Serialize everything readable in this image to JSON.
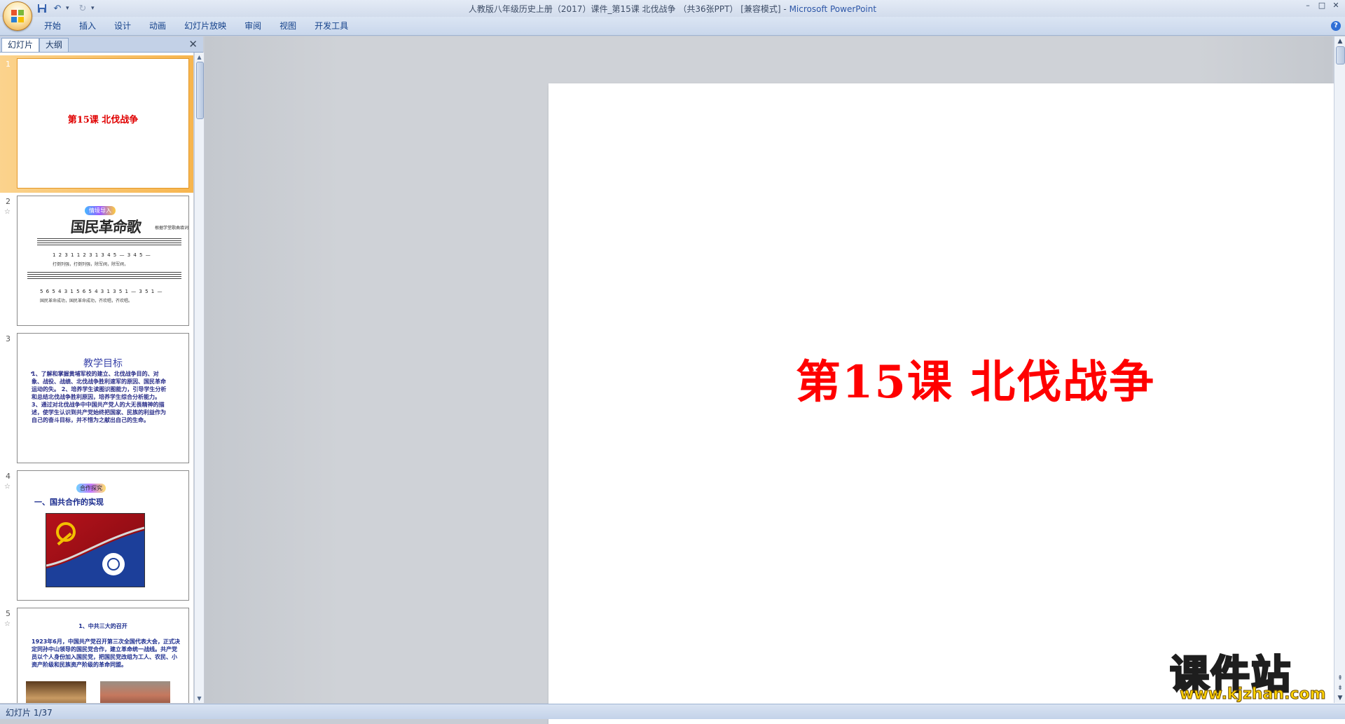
{
  "window": {
    "title_doc": "人教版八年级历史上册（2017）课件_第15课 北伐战争 （共36张PPT） [兼容模式]",
    "title_sep": " - ",
    "title_app": "Microsoft PowerPoint",
    "controls": [
      "–",
      "□",
      "✕"
    ]
  },
  "qat": {
    "save": "save-icon",
    "undo": "undo-icon",
    "redo": "redo-icon"
  },
  "ribbon": {
    "tabs": [
      "开始",
      "插入",
      "设计",
      "动画",
      "幻灯片放映",
      "审阅",
      "视图",
      "开发工具"
    ],
    "help": "?"
  },
  "pane": {
    "tabs": [
      "幻灯片",
      "大纲"
    ],
    "close": "✕"
  },
  "thumbnails": [
    {
      "num": "1",
      "title": "第15课  北伐战争"
    },
    {
      "num": "2",
      "badge": "情境导入",
      "song_title": "国民革命歌",
      "note": "根据学堂歌曲填词",
      "jianpu1": "1 2 3 1  1 2 3 1  3 4 5 —  3 4 5 —",
      "lyrics1": "打倒列强，打倒列强，除军阀，除军阀，",
      "jianpu2": "5 6 5 4 3 1  5 6 5 4 3 1  3 5 1 —  3 5 1 —",
      "lyrics2": "国民革命成功，国民革命成功，齐欢唱，齐欢唱。"
    },
    {
      "num": "3",
      "title": "教学目标",
      "body": "1、了解和掌握黄埔军校的建立、北伐战争目的、对象、战役、战绩、北伐战争胜利速军的原因、国民革命运动的失。 2、培养学生读图识图能力，引导学生分析和总结北伐战争胜利原因，培养学生综合分析能力。 3、通过对北伐战争中中国共产党人的大无畏精神的描述，使学生认识到共产党始终把国家、民族的利益作为自己的奋斗目标，并不惜为之献出自己的生命。"
    },
    {
      "num": "4",
      "badge": "合作探究",
      "section": "一、国共合作的实现"
    },
    {
      "num": "5",
      "title": "1、中共三大的召开",
      "body": "1923年6月，中国共产党召开第三次全国代表大会，正式决定同孙中山领导的国民党合作，建立革命统一战线。共产党员以个人身份加入国民党，把国民党改组为工人、农民、小资产阶级和民族资产阶级的革命同盟。"
    }
  ],
  "main_slide": {
    "title": "第15课  北伐战争"
  },
  "watermark": {
    "main": "课件站",
    "sub": "www.kjzhan.com"
  },
  "status": {
    "slide_info": "幻灯片 1/37"
  }
}
